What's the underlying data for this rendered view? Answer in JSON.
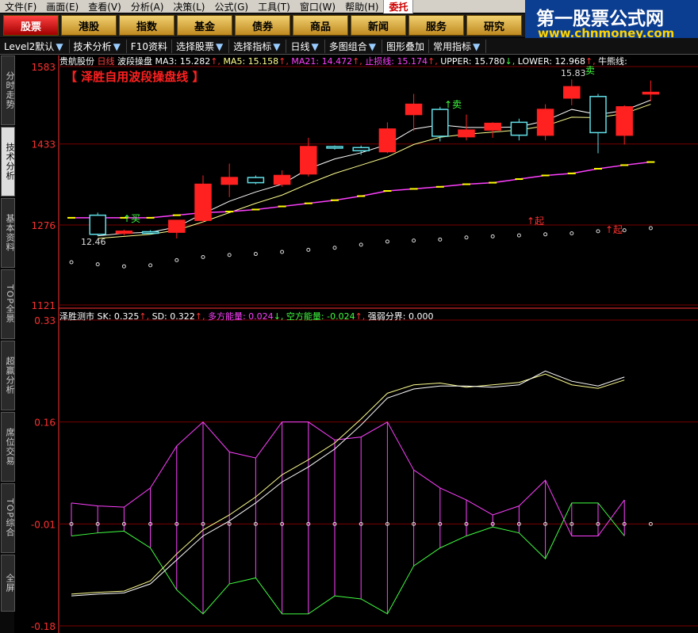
{
  "menu": [
    "文件(F)",
    "画面(E)",
    "查看(V)",
    "分析(A)",
    "决策(L)",
    "公式(G)",
    "工具(T)",
    "窗口(W)",
    "帮助(H)",
    "委托"
  ],
  "top_buttons": [
    {
      "label": "股票",
      "active": true
    },
    {
      "label": "港股",
      "active": false
    },
    {
      "label": "指数",
      "active": false
    },
    {
      "label": "基金",
      "active": false
    },
    {
      "label": "债券",
      "active": false
    },
    {
      "label": "商品",
      "active": false
    },
    {
      "label": "新闻",
      "active": false
    },
    {
      "label": "服务",
      "active": false
    },
    {
      "label": "研究",
      "active": false
    }
  ],
  "brand": {
    "title": "第一股票公式网",
    "url": "www.chnmoney.com"
  },
  "toolbar": [
    "Level2默认",
    "技术分析",
    "F10资料",
    "选择股票",
    "选择指标",
    "日线",
    "多图组合",
    "图形叠加",
    "常用指标"
  ],
  "side_tabs": [
    {
      "label": "分时走势",
      "active": false
    },
    {
      "label": "技术分析",
      "active": true
    },
    {
      "label": "基本资料",
      "active": false
    },
    {
      "label": "TOP全景",
      "active": false
    },
    {
      "label": "超赢分析",
      "active": false
    },
    {
      "label": "席位交易",
      "active": false
    },
    {
      "label": "TOP综合",
      "active": false
    },
    {
      "label": "全屏",
      "active": false
    }
  ],
  "upper_header": {
    "stock": "贵航股份",
    "period": "日线",
    "indicator": "波段操盘",
    "ma3": "MA3: 15.282",
    "ma5": "MA5: 15.158",
    "ma21": "MA21: 14.472",
    "stop": "止损线: 15.174",
    "upper": "UPPER: 15.780",
    "lower": "LOWER: 12.968",
    "bull": "牛熊线:"
  },
  "upper_title": "【 泽胜自用波段操盘线 】",
  "lower_header": {
    "name": "泽胜测市",
    "sk": "SK: 0.325",
    "sd": "SD: 0.322",
    "long": "多方能量: 0.024",
    "short": "空方能量: -0.024",
    "split": "强弱分界: 0.000"
  },
  "annotations": {
    "sell": "卖",
    "buy": "买",
    "start": "起",
    "low_label": "12.46",
    "high_label": "15.83"
  },
  "colors": {
    "up": "#ff2020",
    "down": "#60e0e8",
    "ma": "#ffffff",
    "ma2": "#ffff90",
    "bull": "#ff40ff",
    "long": "#ff40ff",
    "short": "#40ff40",
    "grid": "#7a0000",
    "axis": "#ff3030"
  },
  "chart_data": [
    {
      "type": "line",
      "title": "泽胜自用波段操盘线",
      "ylim": [
        1121,
        1583
      ],
      "yticks": [
        "1583",
        "1433",
        "1276",
        "1121"
      ],
      "candles": [
        {
          "o": 1295,
          "h": 1300,
          "l": 1255,
          "c": 1258
        },
        {
          "o": 1260,
          "h": 1267,
          "l": 1256,
          "c": 1264
        },
        {
          "o": 1263,
          "h": 1266,
          "l": 1258,
          "c": 1262
        },
        {
          "o": 1262,
          "h": 1268,
          "l": 1250,
          "c": 1285
        },
        {
          "o": 1285,
          "h": 1372,
          "l": 1280,
          "c": 1355
        },
        {
          "o": 1355,
          "h": 1395,
          "l": 1330,
          "c": 1368
        },
        {
          "o": 1368,
          "h": 1372,
          "l": 1355,
          "c": 1358
        },
        {
          "o": 1355,
          "h": 1382,
          "l": 1350,
          "c": 1372
        },
        {
          "o": 1375,
          "h": 1445,
          "l": 1370,
          "c": 1428
        },
        {
          "o": 1428,
          "h": 1430,
          "l": 1422,
          "c": 1425
        },
        {
          "o": 1426,
          "h": 1430,
          "l": 1412,
          "c": 1420
        },
        {
          "o": 1418,
          "h": 1475,
          "l": 1415,
          "c": 1462
        },
        {
          "o": 1490,
          "h": 1530,
          "l": 1458,
          "c": 1510
        },
        {
          "o": 1500,
          "h": 1505,
          "l": 1438,
          "c": 1448
        },
        {
          "o": 1447,
          "h": 1490,
          "l": 1440,
          "c": 1460
        },
        {
          "o": 1460,
          "h": 1475,
          "l": 1445,
          "c": 1473
        },
        {
          "o": 1475,
          "h": 1482,
          "l": 1440,
          "c": 1450
        },
        {
          "o": 1450,
          "h": 1510,
          "l": 1440,
          "c": 1500
        },
        {
          "o": 1522,
          "h": 1558,
          "l": 1508,
          "c": 1544
        },
        {
          "o": 1525,
          "h": 1530,
          "l": 1415,
          "c": 1455
        },
        {
          "o": 1450,
          "h": 1508,
          "l": 1432,
          "c": 1505
        },
        {
          "o": 1530,
          "h": 1556,
          "l": 1516,
          "c": 1533
        }
      ],
      "ma_a": [
        1255,
        1260,
        1262,
        1272,
        1298,
        1322,
        1340,
        1355,
        1385,
        1404,
        1416,
        1432,
        1462,
        1470,
        1465,
        1465,
        1466,
        1478,
        1500,
        1490,
        1498,
        1518
      ],
      "ma_b": [
        1250,
        1254,
        1258,
        1266,
        1282,
        1300,
        1318,
        1334,
        1356,
        1376,
        1392,
        1408,
        1432,
        1446,
        1452,
        1456,
        1460,
        1468,
        1485,
        1484,
        1492,
        1510
      ],
      "bull": [
        1290,
        1290,
        1290,
        1290,
        1295,
        1300,
        1302,
        1306,
        1312,
        1318,
        1324,
        1332,
        1342,
        1346,
        1350,
        1355,
        1358,
        1365,
        1372,
        1376,
        1385,
        1392,
        1398
      ],
      "dots": [
        1296,
        1292,
        1288,
        1290,
        1300,
        1306,
        1310,
        1312,
        1316,
        1320,
        1324,
        1330,
        1336,
        1338,
        1340,
        1344,
        1346,
        1348,
        1350,
        1352,
        1356,
        1358,
        1362
      ]
    },
    {
      "type": "line",
      "title": "泽胜测市",
      "ylim": [
        -0.18,
        0.33
      ],
      "yticks": [
        "0.33",
        "0.16",
        "-0.01",
        "-0.18"
      ],
      "series": [
        {
          "name": "SK",
          "values": [
            -0.13,
            -0.127,
            -0.125,
            -0.11,
            -0.07,
            -0.03,
            -0.005,
            0.025,
            0.06,
            0.085,
            0.115,
            0.155,
            0.2,
            0.215,
            0.22,
            0.22,
            0.218,
            0.222,
            0.245,
            0.228,
            0.22,
            0.235,
            0.24
          ]
        },
        {
          "name": "SD",
          "values": [
            -0.127,
            -0.124,
            -0.122,
            -0.105,
            -0.06,
            -0.02,
            0.005,
            0.035,
            0.072,
            0.097,
            0.125,
            0.165,
            0.208,
            0.222,
            0.225,
            0.218,
            0.222,
            0.226,
            0.24,
            0.222,
            0.216,
            0.23,
            0.236
          ]
        },
        {
          "name": "多方能量",
          "values": [
            0.025,
            0.02,
            0.018,
            0.05,
            0.12,
            0.16,
            0.11,
            0.1,
            0.16,
            0.16,
            0.13,
            0.135,
            0.16,
            0.08,
            0.05,
            0.03,
            0.005,
            0.02,
            0.063,
            -0.03,
            -0.03,
            0.03,
            0.022
          ]
        },
        {
          "name": "空方能量",
          "values": [
            -0.03,
            -0.025,
            -0.022,
            -0.05,
            -0.12,
            -0.16,
            -0.11,
            -0.1,
            -0.16,
            -0.16,
            -0.13,
            -0.135,
            -0.16,
            -0.08,
            -0.05,
            -0.03,
            -0.015,
            -0.025,
            -0.068,
            0.025,
            0.025,
            -0.03,
            -0.024
          ]
        }
      ]
    }
  ]
}
